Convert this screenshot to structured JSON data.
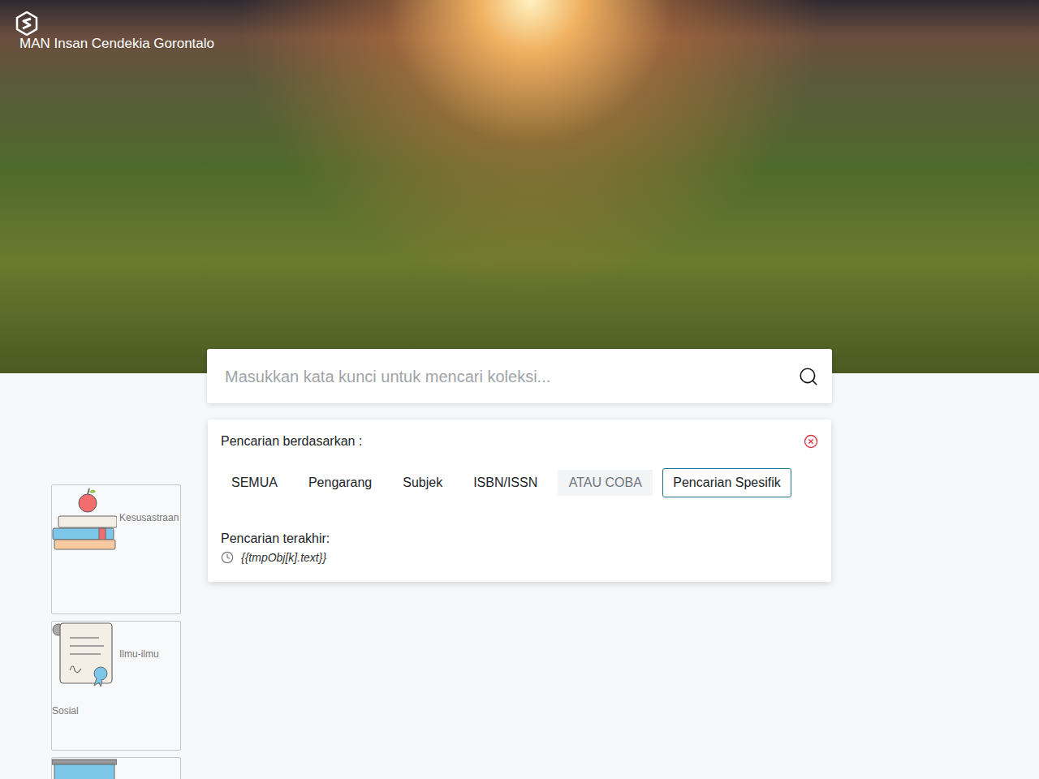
{
  "site": {
    "title": "MAN Insan Cendekia Gorontalo"
  },
  "search": {
    "placeholder": "Masukkan kata kunci untuk mencari koleksi..."
  },
  "filter_panel": {
    "heading": "Pencarian berdasarkan :",
    "filters": [
      {
        "label": "SEMUA",
        "kind": "option",
        "selected": false
      },
      {
        "label": "Pengarang",
        "kind": "option",
        "selected": false
      },
      {
        "label": "Subjek",
        "kind": "option",
        "selected": false
      },
      {
        "label": "ISBN/ISSN",
        "kind": "option",
        "selected": false
      },
      {
        "label": "ATAU COBA",
        "kind": "separator",
        "selected": false
      },
      {
        "label": "Pencarian Spesifik",
        "kind": "option",
        "selected": true
      }
    ],
    "recent_heading": "Pencarian terakhir:",
    "recent": [
      "{{tmpObj[k].text}}"
    ]
  },
  "categories": [
    {
      "label": "Kesusastraan"
    },
    {
      "label": "Ilmu-ilmu Sosial"
    },
    {
      "label": null
    }
  ]
}
